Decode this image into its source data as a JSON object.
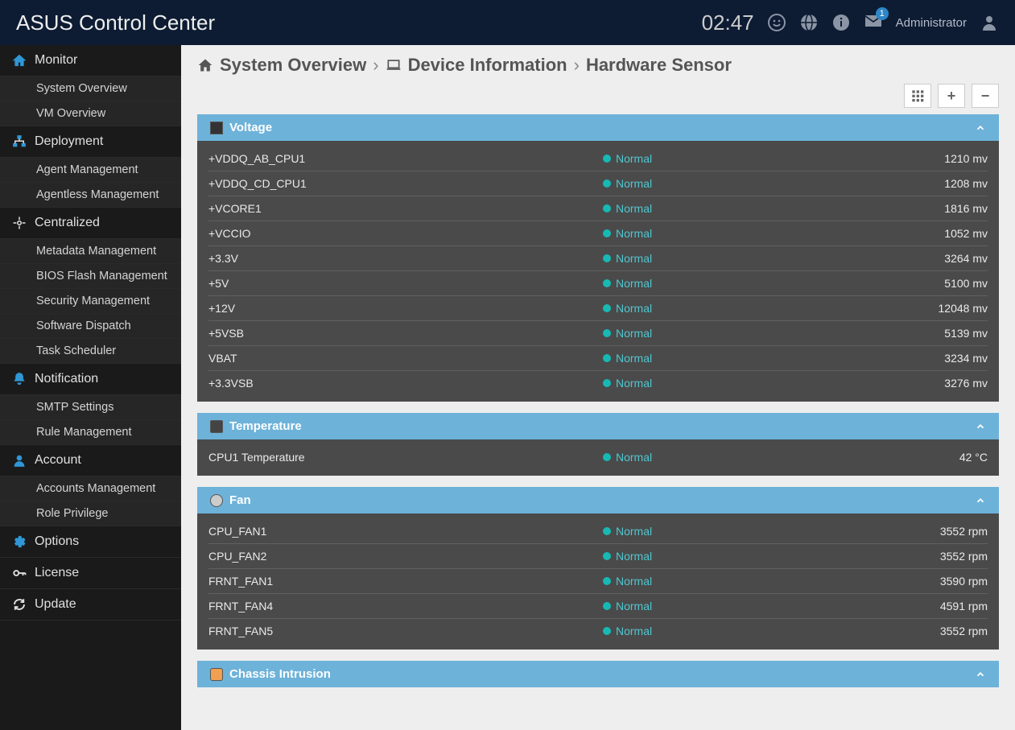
{
  "header": {
    "title": "ASUS Control Center",
    "time": "02:47",
    "badge": "1",
    "user": "Administrator"
  },
  "nav": [
    {
      "label": "Monitor",
      "icon": "home",
      "color": "#2f97d6",
      "children": [
        "System Overview",
        "VM Overview"
      ]
    },
    {
      "label": "Deployment",
      "icon": "sitemap",
      "color": "#2f97d6",
      "children": [
        "Agent Management",
        "Agentless Management"
      ]
    },
    {
      "label": "Centralized",
      "icon": "crosshair",
      "color": "#2f97d6",
      "children": [
        "Metadata Management",
        "BIOS Flash Management",
        "Security Management",
        "Software Dispatch",
        "Task Scheduler"
      ]
    },
    {
      "label": "Notification",
      "icon": "bell",
      "color": "#2f97d6",
      "children": [
        "SMTP Settings",
        "Rule Management"
      ]
    },
    {
      "label": "Account",
      "icon": "user",
      "color": "#2f97d6",
      "children": [
        "Accounts Management",
        "Role Privilege"
      ]
    },
    {
      "label": "Options",
      "icon": "gear",
      "color": "#2f97d6",
      "children": []
    },
    {
      "label": "License",
      "icon": "key",
      "color": "#2f97d6",
      "children": []
    },
    {
      "label": "Update",
      "icon": "refresh",
      "color": "#2f97d6",
      "children": []
    }
  ],
  "breadcrumb": {
    "a": "System Overview",
    "b": "Device Information",
    "c": "Hardware Sensor"
  },
  "panels": [
    {
      "title": "Voltage",
      "iconClass": "",
      "rows": [
        {
          "name": "+VDDQ_AB_CPU1",
          "status": "Normal",
          "value": "1210 mv"
        },
        {
          "name": "+VDDQ_CD_CPU1",
          "status": "Normal",
          "value": "1208 mv"
        },
        {
          "name": "+VCORE1",
          "status": "Normal",
          "value": "1816 mv"
        },
        {
          "name": "+VCCIO",
          "status": "Normal",
          "value": "1052 mv"
        },
        {
          "name": "+3.3V",
          "status": "Normal",
          "value": "3264 mv"
        },
        {
          "name": "+5V",
          "status": "Normal",
          "value": "5100 mv"
        },
        {
          "name": "+12V",
          "status": "Normal",
          "value": "12048 mv"
        },
        {
          "name": "+5VSB",
          "status": "Normal",
          "value": "5139 mv"
        },
        {
          "name": "VBAT",
          "status": "Normal",
          "value": "3234 mv"
        },
        {
          "name": "+3.3VSB",
          "status": "Normal",
          "value": "3276 mv"
        }
      ]
    },
    {
      "title": "Temperature",
      "iconClass": "t",
      "rows": [
        {
          "name": "CPU1 Temperature",
          "status": "Normal",
          "value": "42 °C"
        }
      ]
    },
    {
      "title": "Fan",
      "iconClass": "f",
      "rows": [
        {
          "name": "CPU_FAN1",
          "status": "Normal",
          "value": "3552 rpm"
        },
        {
          "name": "CPU_FAN2",
          "status": "Normal",
          "value": "3552 rpm"
        },
        {
          "name": "FRNT_FAN1",
          "status": "Normal",
          "value": "3590 rpm"
        },
        {
          "name": "FRNT_FAN4",
          "status": "Normal",
          "value": "4591 rpm"
        },
        {
          "name": "FRNT_FAN5",
          "status": "Normal",
          "value": "3552 rpm"
        }
      ]
    },
    {
      "title": "Chassis Intrusion",
      "iconClass": "c",
      "rows": []
    }
  ]
}
